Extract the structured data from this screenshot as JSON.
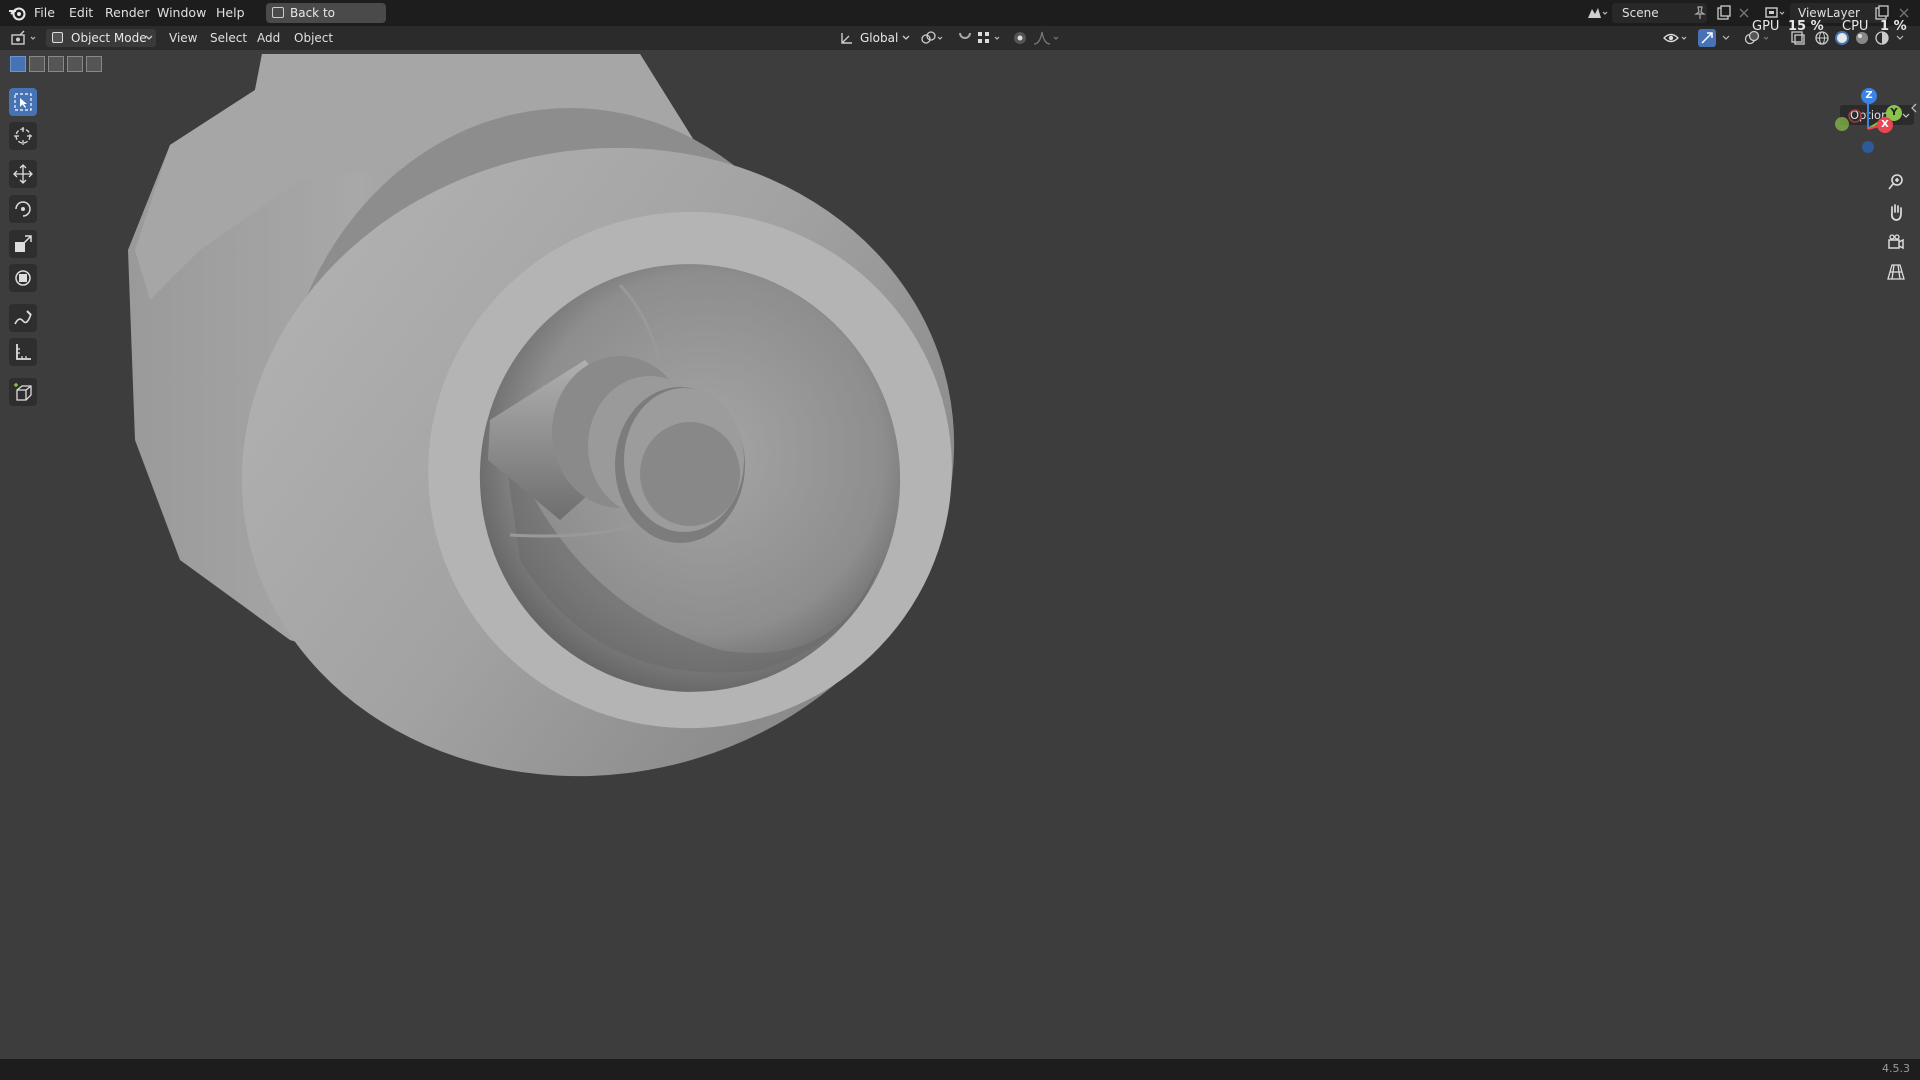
{
  "menu": {
    "items": [
      "File",
      "Edit",
      "Render",
      "Window",
      "Help"
    ],
    "back_button": "Back to Previous"
  },
  "scene": {
    "name": "Scene",
    "view_layer": "ViewLayer"
  },
  "stats": {
    "gpu_label": "GPU",
    "gpu_value": "15 %",
    "cpu_label": "CPU",
    "cpu_value": "1 %"
  },
  "header": {
    "mode": "Object Mode",
    "menus": [
      "View",
      "Select",
      "Add",
      "Object"
    ],
    "transform_orientation": "Global"
  },
  "viewport": {
    "options_label": "Options",
    "gizmo": {
      "z": "Z",
      "y": "Y",
      "x": "X"
    }
  },
  "tools": [
    "select-box",
    "cursor",
    "move",
    "rotate",
    "scale",
    "transform",
    "annotate",
    "measure",
    "add-cube"
  ],
  "status": {
    "version": "4.5.3"
  },
  "colors": {
    "accent": "#4772b3",
    "axis_x": "#e84652",
    "axis_y": "#8bc34a",
    "axis_z": "#3b82e6",
    "background": "#3d3d3d"
  }
}
